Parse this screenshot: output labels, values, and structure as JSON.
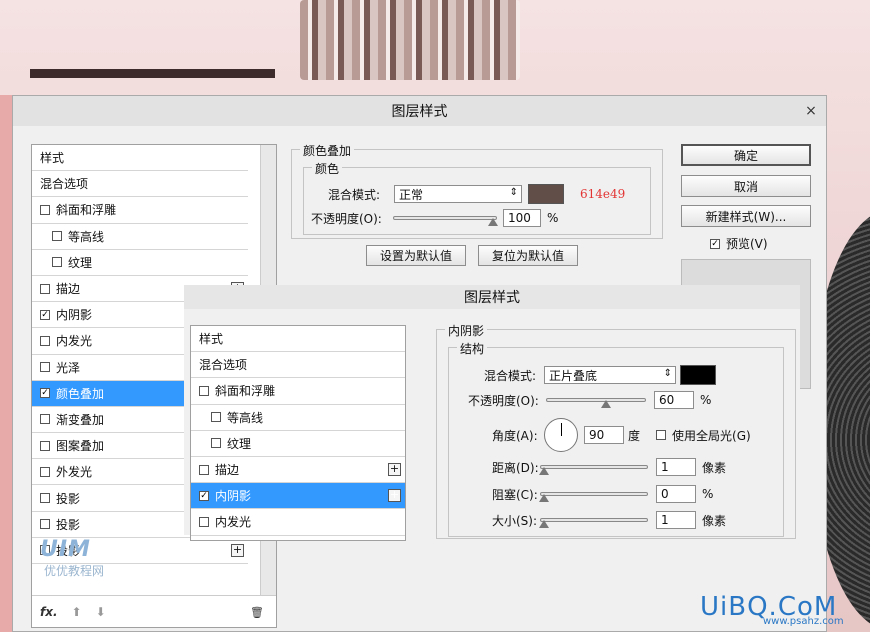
{
  "colors": {
    "selected": "#3399ff",
    "overlay_swatch": "#614e49",
    "shadow_swatch": "#000000",
    "annotation": "#e33333"
  },
  "dialog": {
    "title": "图层样式",
    "close": "×",
    "styles": [
      {
        "label": "样式",
        "checkbox": false,
        "checked": false,
        "indent": false,
        "plus": false,
        "selected": false
      },
      {
        "label": "混合选项",
        "checkbox": false,
        "checked": false,
        "indent": false,
        "plus": false,
        "selected": false
      },
      {
        "label": "斜面和浮雕",
        "checkbox": true,
        "checked": false,
        "indent": false,
        "plus": false,
        "selected": false
      },
      {
        "label": "等高线",
        "checkbox": true,
        "checked": false,
        "indent": true,
        "plus": false,
        "selected": false
      },
      {
        "label": "纹理",
        "checkbox": true,
        "checked": false,
        "indent": true,
        "plus": false,
        "selected": false
      },
      {
        "label": "描边",
        "checkbox": true,
        "checked": false,
        "indent": false,
        "plus": true,
        "selected": false
      },
      {
        "label": "内阴影",
        "checkbox": true,
        "checked": true,
        "indent": false,
        "plus": true,
        "selected": false
      },
      {
        "label": "内发光",
        "checkbox": true,
        "checked": false,
        "indent": false,
        "plus": false,
        "selected": false
      },
      {
        "label": "光泽",
        "checkbox": true,
        "checked": false,
        "indent": false,
        "plus": false,
        "selected": false
      },
      {
        "label": "颜色叠加",
        "checkbox": true,
        "checked": true,
        "indent": false,
        "plus": true,
        "selected": true
      },
      {
        "label": "渐变叠加",
        "checkbox": true,
        "checked": false,
        "indent": false,
        "plus": true,
        "selected": false
      },
      {
        "label": "图案叠加",
        "checkbox": true,
        "checked": false,
        "indent": false,
        "plus": false,
        "selected": false
      },
      {
        "label": "外发光",
        "checkbox": true,
        "checked": false,
        "indent": false,
        "plus": false,
        "selected": false
      },
      {
        "label": "投影",
        "checkbox": true,
        "checked": false,
        "indent": false,
        "plus": true,
        "selected": false
      },
      {
        "label": "投影",
        "checkbox": true,
        "checked": false,
        "indent": false,
        "plus": true,
        "selected": false
      },
      {
        "label": "投影",
        "checkbox": true,
        "checked": false,
        "indent": false,
        "plus": true,
        "selected": false
      }
    ],
    "footer": {
      "fx": "fx.",
      "up": "⬆",
      "down": "⬇",
      "trash": "🗑"
    },
    "color_overlay": {
      "section_title": "颜色叠加",
      "group_title": "颜色",
      "blend_label": "混合模式:",
      "blend_value": "正常",
      "hex_note": "614e49",
      "opacity_label": "不透明度(O):",
      "opacity_value": "100",
      "opacity_unit": "%",
      "opacity_level": 1.0,
      "set_default": "设置为默认值",
      "reset_default": "复位为默认值"
    },
    "buttons": {
      "ok": "确定",
      "cancel": "取消",
      "new_style": "新建样式(W)...",
      "preview": "预览(V)"
    }
  },
  "dialog2": {
    "title": "图层样式",
    "styles": [
      {
        "label": "样式",
        "checkbox": false,
        "checked": false,
        "indent": false,
        "plus": false,
        "selected": false
      },
      {
        "label": "混合选项",
        "checkbox": false,
        "checked": false,
        "indent": false,
        "plus": false,
        "selected": false
      },
      {
        "label": "斜面和浮雕",
        "checkbox": true,
        "checked": false,
        "indent": false,
        "plus": false,
        "selected": false
      },
      {
        "label": "等高线",
        "checkbox": true,
        "checked": false,
        "indent": true,
        "plus": false,
        "selected": false
      },
      {
        "label": "纹理",
        "checkbox": true,
        "checked": false,
        "indent": true,
        "plus": false,
        "selected": false
      },
      {
        "label": "描边",
        "checkbox": true,
        "checked": false,
        "indent": false,
        "plus": true,
        "selected": false
      },
      {
        "label": "内阴影",
        "checkbox": true,
        "checked": true,
        "indent": false,
        "plus": true,
        "selected": true
      },
      {
        "label": "内发光",
        "checkbox": true,
        "checked": false,
        "indent": false,
        "plus": false,
        "selected": false
      }
    ],
    "inner_shadow": {
      "section_title": "内阴影",
      "group_title": "结构",
      "blend_label": "混合模式:",
      "blend_value": "正片叠底",
      "opacity_label": "不透明度(O):",
      "opacity_value": "60",
      "opacity_unit": "%",
      "opacity_level": 0.6,
      "angle_label": "角度(A):",
      "angle_value": "90",
      "angle_unit": "度",
      "global_light": "使用全局光(G)",
      "distance_label": "距离(D):",
      "distance_value": "1",
      "distance_unit": "像素",
      "choke_label": "阻塞(C):",
      "choke_value": "0",
      "choke_unit": "%",
      "size_label": "大小(S):",
      "size_value": "1",
      "size_unit": "像素"
    }
  },
  "watermark": {
    "brand": "UIM",
    "sub": "优优教程网",
    "site": "UiBQ.CoM",
    "url": "www.psahz.com"
  }
}
